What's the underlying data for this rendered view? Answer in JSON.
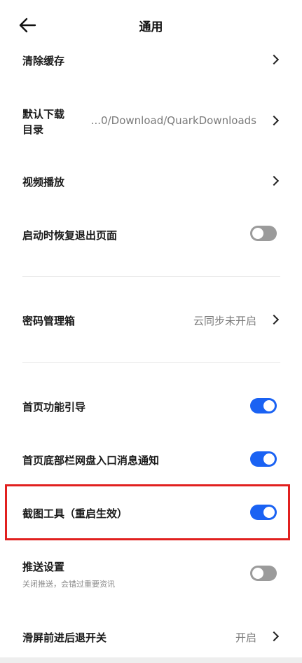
{
  "header": {
    "title": "通用",
    "back_icon": "arrow-left-icon"
  },
  "settings": {
    "clear_cache": {
      "label": "清除缓存"
    },
    "download_dir": {
      "label_line1": "默认下载",
      "label_line2": "目录",
      "value": "...0/Download/QuarkDownloads"
    },
    "video_playback": {
      "label": "视频播放"
    },
    "restore_pages": {
      "label": "启动时恢复退出页面",
      "enabled": false
    },
    "password_manager": {
      "label": "密码管理箱",
      "value": "云同步未开启"
    },
    "homepage_guide": {
      "label": "首页功能引导",
      "enabled": true
    },
    "bottom_bar_notify": {
      "label": "首页底部栏网盘入口消息通知",
      "enabled": true
    },
    "screenshot_tool": {
      "label": "截图工具（重启生效）",
      "enabled": true
    },
    "push_settings": {
      "label": "推送设置",
      "sub": "关闭推送，会错过重要资讯",
      "enabled": false
    },
    "swipe_nav": {
      "label": "滑屏前进后退开关",
      "value": "开启"
    }
  },
  "colors": {
    "toggle_on": "#1a62f3",
    "toggle_off": "#9b9b9b",
    "highlight_border": "#e1201f"
  }
}
